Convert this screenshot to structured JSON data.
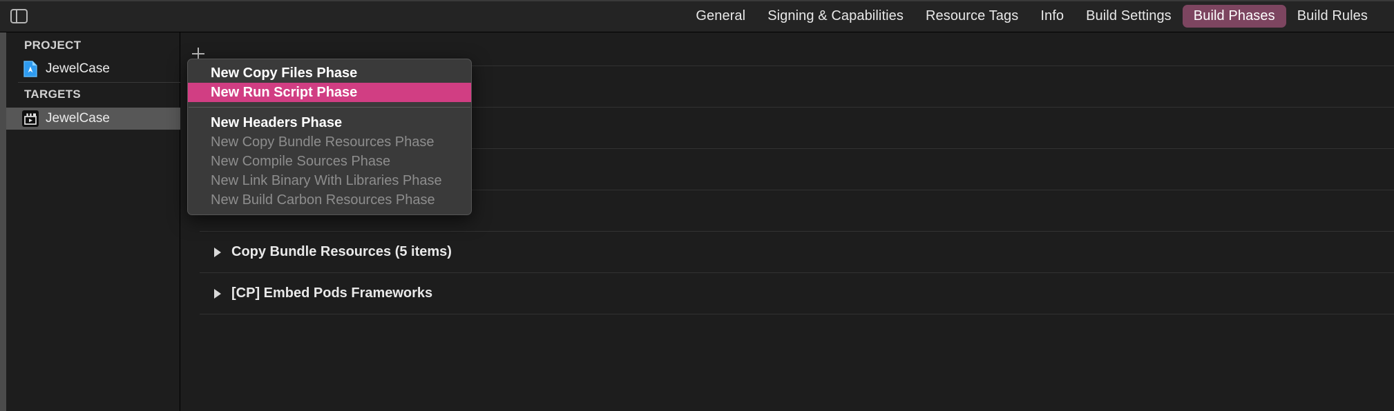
{
  "topbar": {
    "sidebar_toggle_icon": "sidebar-toggle-icon",
    "tabs": [
      {
        "label": "General",
        "active": false
      },
      {
        "label": "Signing & Capabilities",
        "active": false
      },
      {
        "label": "Resource Tags",
        "active": false
      },
      {
        "label": "Info",
        "active": false
      },
      {
        "label": "Build Settings",
        "active": false
      },
      {
        "label": "Build Phases",
        "active": true
      },
      {
        "label": "Build Rules",
        "active": false
      }
    ],
    "active_tab_color": "#7d4560"
  },
  "sidebar": {
    "sections": [
      {
        "header": "PROJECT",
        "items": [
          {
            "label": "JewelCase",
            "icon": "xcode-project-icon",
            "selected": false
          }
        ]
      },
      {
        "header": "TARGETS",
        "items": [
          {
            "label": "JewelCase",
            "icon": "app-target-icon",
            "selected": true
          }
        ]
      }
    ],
    "selection_color": "#575757"
  },
  "content": {
    "add_button_icon": "plus-icon",
    "phases": [
      {
        "label": "Copy Bundle Resources (5 items)",
        "expanded": false,
        "icon": "disclosure-triangle-icon"
      },
      {
        "label": "[CP] Embed Pods Frameworks",
        "expanded": false,
        "icon": "disclosure-triangle-icon"
      }
    ]
  },
  "menu": {
    "highlight_color": "#d13e83",
    "items": [
      {
        "label": "New Copy Files Phase",
        "state": "enabled"
      },
      {
        "label": "New Run Script Phase",
        "state": "highlighted"
      },
      {
        "separator": true
      },
      {
        "label": "New Headers Phase",
        "state": "enabled"
      },
      {
        "label": "New Copy Bundle Resources Phase",
        "state": "disabled"
      },
      {
        "label": "New Compile Sources Phase",
        "state": "disabled"
      },
      {
        "label": "New Link Binary With Libraries Phase",
        "state": "disabled"
      },
      {
        "label": "New Build Carbon Resources Phase",
        "state": "disabled"
      }
    ]
  }
}
